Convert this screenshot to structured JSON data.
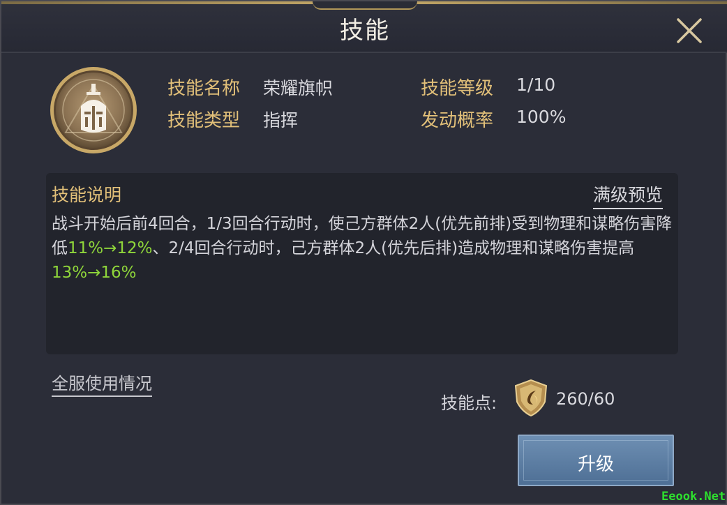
{
  "header": {
    "title": "技能"
  },
  "skill": {
    "icon": "helmet-sword-emblem-icon",
    "name_label": "技能名称",
    "name_value": "荣耀旗帜",
    "level_label": "技能等级",
    "level_value": "1/10",
    "type_label": "技能类型",
    "type_value": "指挥",
    "chance_label": "发动概率",
    "chance_value": "100%"
  },
  "description": {
    "title": "技能说明",
    "preview_link": "满级预览",
    "seg1": "战斗开始后前4回合，1/3回合行动时，使己方群体2人(优先前排)受到物理和谋略伤害降低",
    "hl1": "11%→12%",
    "seg2": "、2/4回合行动时，己方群体2人(优先后排)造成物理和谋略伤害提高",
    "hl2": "13%→16%"
  },
  "footer": {
    "server_usage_link": "全服使用情况",
    "points_label": "技能点:",
    "points_icon": "skill-point-shield-icon",
    "points_value": "260/60",
    "upgrade_label": "升级"
  },
  "watermark": "Eeook.Net",
  "colors": {
    "gold_label": "#e2c079",
    "highlight_green": "#8fd63a",
    "button_blue": "#5a7ca3",
    "panel_bg": "#2b2d38"
  }
}
